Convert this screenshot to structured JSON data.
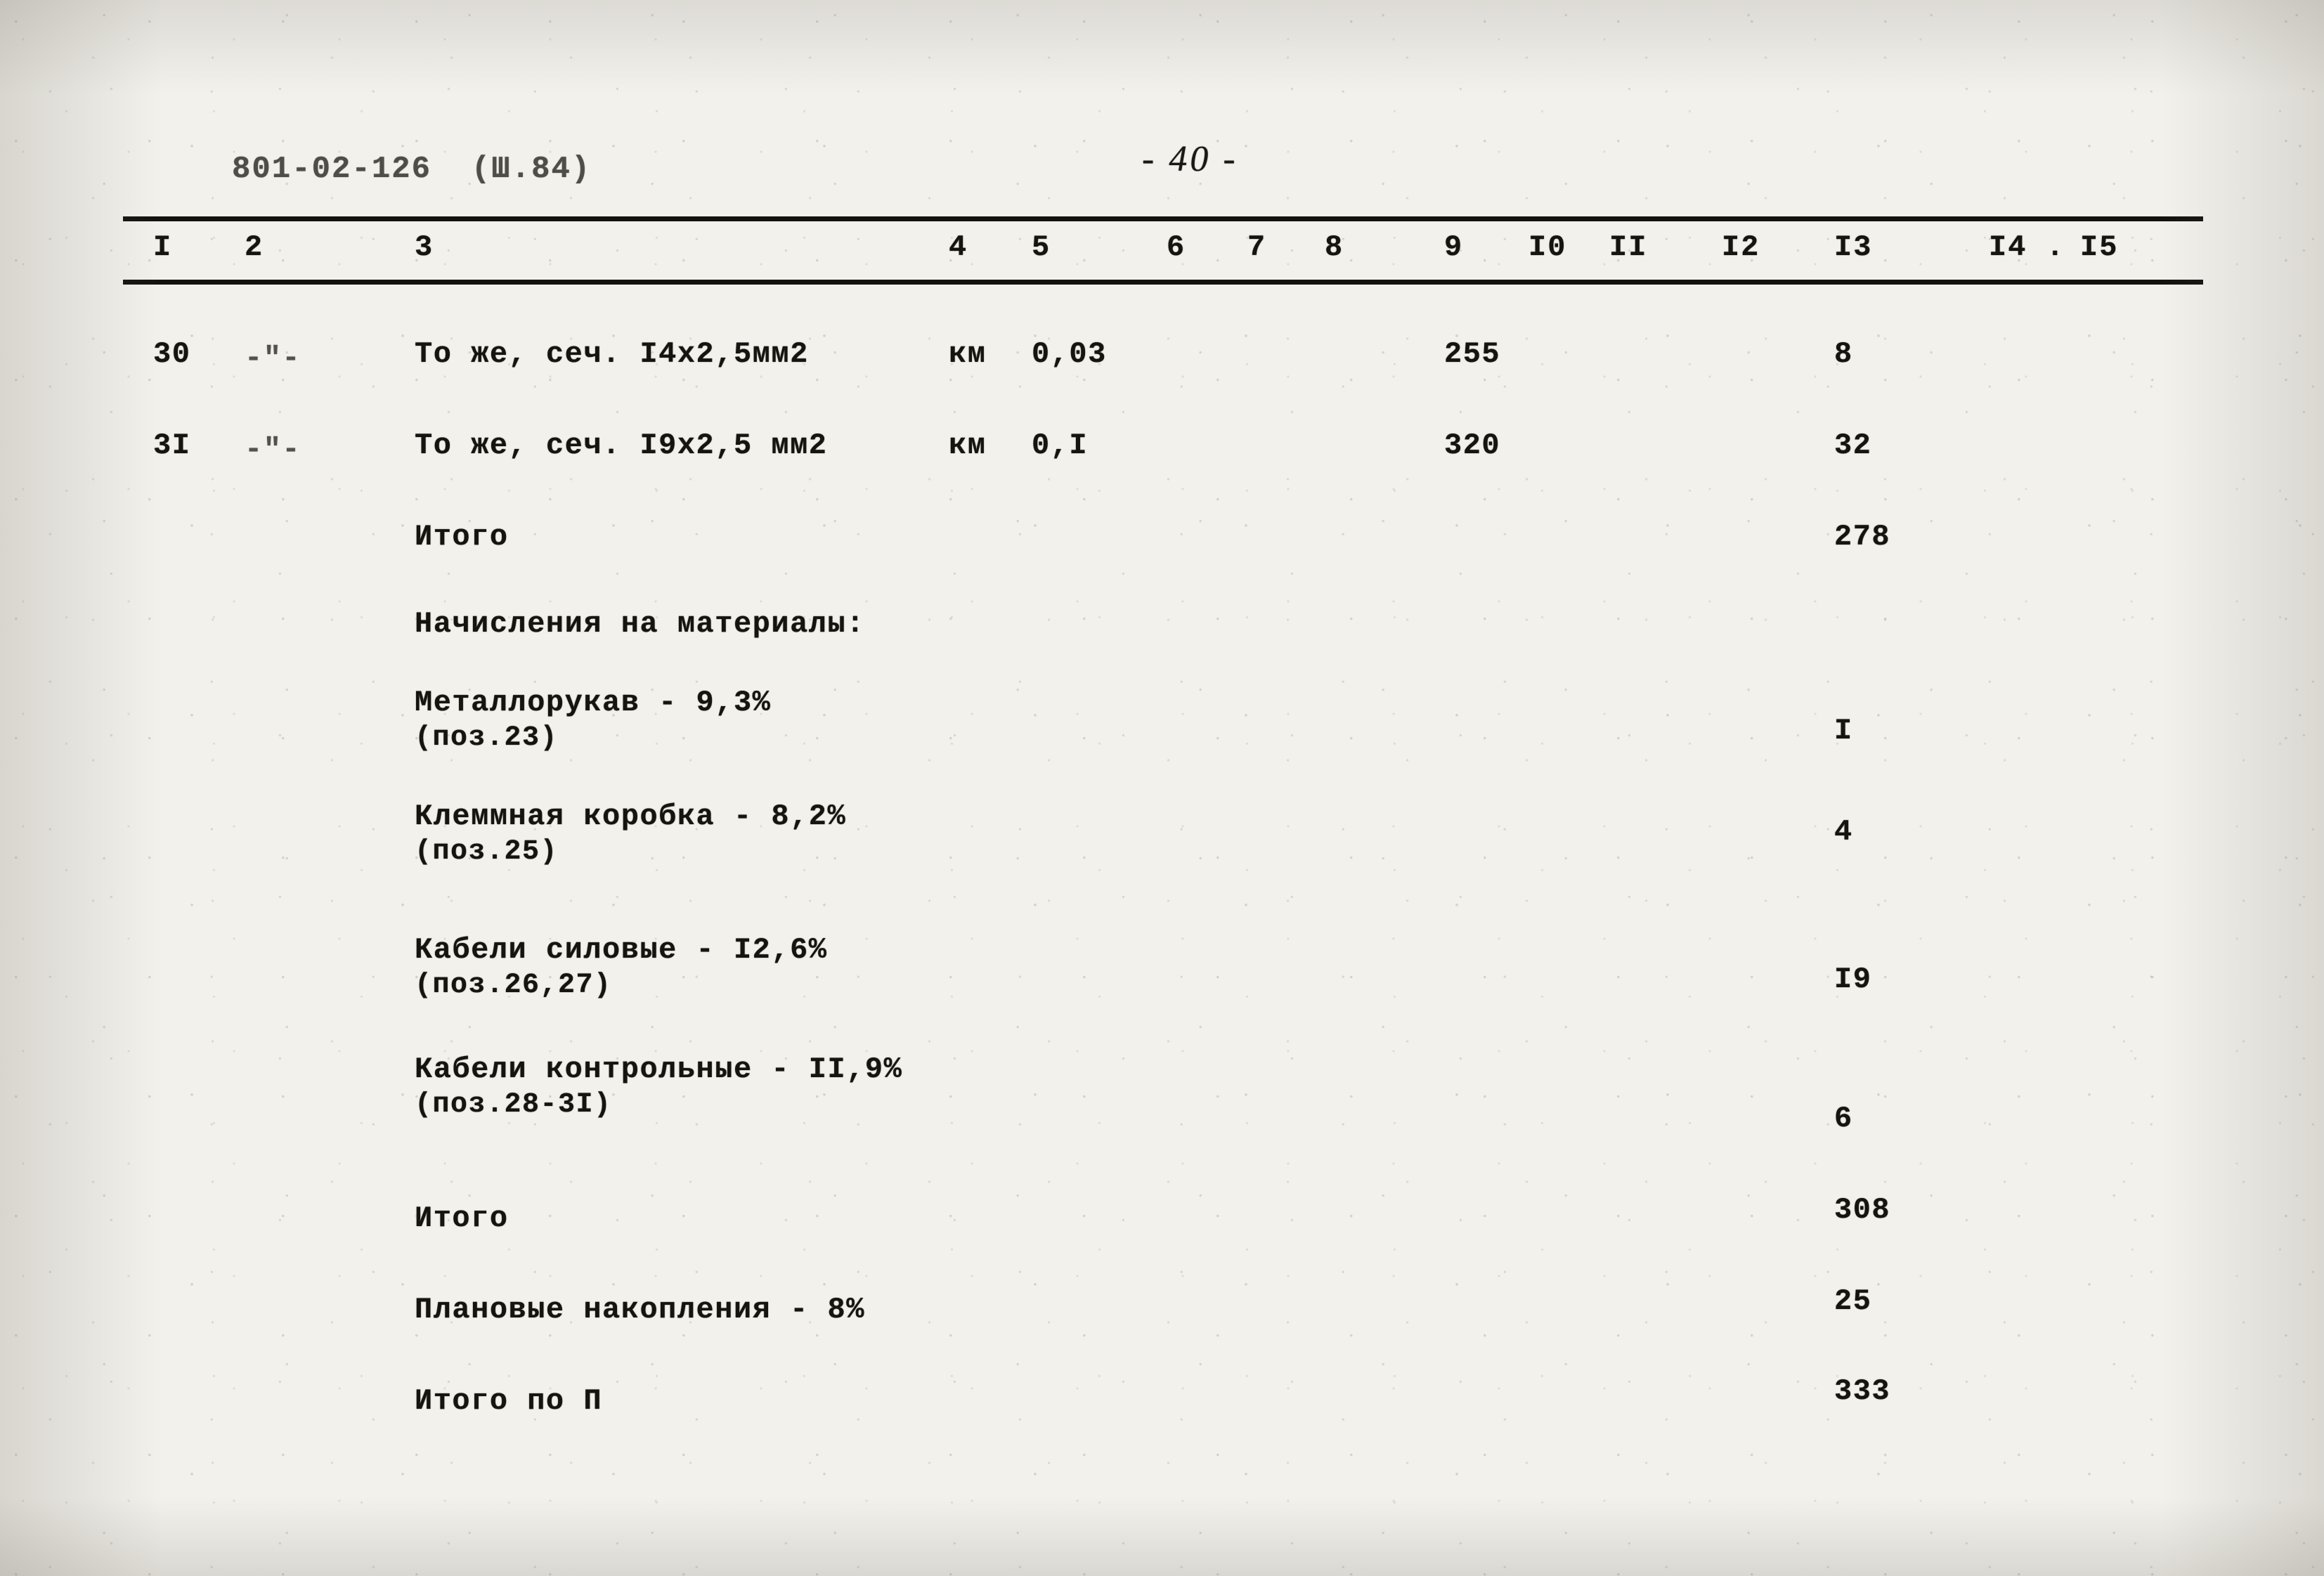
{
  "header": {
    "doc_code": "801-02-126  (Ш.84)",
    "page_number": "- 40 -"
  },
  "table": {
    "column_numbers": [
      "I",
      "2",
      "3",
      "4",
      "5",
      "6",
      "7",
      "8",
      "9",
      "I0",
      "II",
      "I2",
      "I3",
      "I4 .",
      "I5"
    ],
    "rows": [
      {
        "pos": "30",
        "ditto": "-\"-",
        "name": "То же, сеч. I4x2,5мм2",
        "unit": "км",
        "qty": "0,03",
        "c9": "255",
        "c13": "8"
      },
      {
        "pos": "3I",
        "ditto": "-\"-",
        "name": "То же, сеч. I9x2,5 мм2",
        "unit": "км",
        "qty": "0,I",
        "c9": "320",
        "c13": "32"
      },
      {
        "pos": "",
        "ditto": "",
        "name": "Итого",
        "unit": "",
        "qty": "",
        "c9": "",
        "c13": "278"
      }
    ],
    "accruals_heading": "Начисления на материалы:",
    "accruals": [
      {
        "name": "Металлорукав - 9,3%",
        "ref": "(поз.23)",
        "c13": "I"
      },
      {
        "name": "Клеммная коробка - 8,2%",
        "ref": "(поз.25)",
        "c13": "4"
      },
      {
        "name": "Кабели силовые - I2,6%",
        "ref": "(поз.26,27)",
        "c13": "I9"
      },
      {
        "name": "Кабели контрольные - II,9%",
        "ref": "(поз.28-3I)",
        "c13": "6"
      }
    ],
    "footer_rows": [
      {
        "name": "Итого",
        "c13": "308"
      },
      {
        "name": "Плановые накопления - 8%",
        "c13": "25"
      },
      {
        "name": "Итого по П",
        "c13": "333"
      }
    ]
  }
}
